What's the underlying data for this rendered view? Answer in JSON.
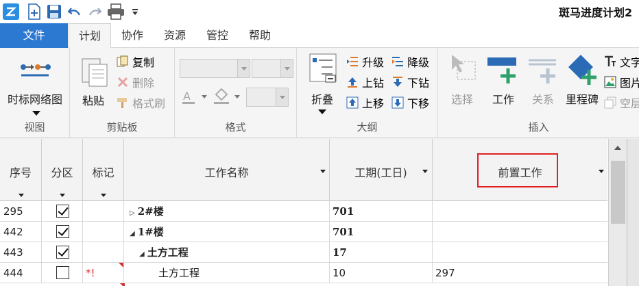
{
  "window": {
    "title": "斑马进度计划2"
  },
  "quick_access": {
    "icons": [
      "app-logo-icon",
      "new-file-icon",
      "save-icon",
      "undo-icon",
      "redo-icon",
      "print-icon",
      "customize-dropdown-icon"
    ]
  },
  "tabs": [
    {
      "label": "文件"
    },
    {
      "label": "计划"
    },
    {
      "label": "协作"
    },
    {
      "label": "资源"
    },
    {
      "label": "管控"
    },
    {
      "label": "帮助"
    }
  ],
  "ribbon": {
    "view": {
      "button": "时标网络图",
      "group": "视图"
    },
    "clipboard": {
      "paste": "粘贴",
      "copy": "复制",
      "delete": "删除",
      "format_painter": "格式刷",
      "group": "剪贴板"
    },
    "format": {
      "group": "格式"
    },
    "outline": {
      "fold": "折叠",
      "upgrade": "升级",
      "downgrade": "降级",
      "drill_up": "上钻",
      "drill_down": "下钻",
      "move_up": "上移",
      "move_down": "下移",
      "group": "大纲"
    },
    "insert": {
      "select": "选择",
      "task": "工作",
      "relation": "关系",
      "milestone": "里程碑",
      "text": "文字",
      "picture": "图片",
      "empty": "空层",
      "group": "插入"
    }
  },
  "grid": {
    "columns": [
      "序号",
      "分区",
      "标记",
      "工作名称",
      "工期(工日)",
      "前置工作"
    ],
    "rows": [
      {
        "seq": "295",
        "checked": true,
        "mark": "",
        "name": "2#楼",
        "duration": "701",
        "pred": "",
        "bold": true,
        "expander": "▷",
        "indent": 0
      },
      {
        "seq": "442",
        "checked": true,
        "mark": "",
        "name": "1#楼",
        "duration": "701",
        "pred": "",
        "bold": true,
        "expander": "◢",
        "indent": 0
      },
      {
        "seq": "443",
        "checked": true,
        "mark": "",
        "name": "土方工程",
        "duration": "17",
        "pred": "",
        "bold": true,
        "expander": "◢",
        "indent": 1
      },
      {
        "seq": "444",
        "checked": false,
        "mark": "*!",
        "name": "土方工程",
        "duration": "10",
        "pred": "297",
        "bold": false,
        "expander": "",
        "indent": 2
      }
    ]
  },
  "colors": {
    "accent": "#2b79d0",
    "highlight": "#e02020",
    "mark_red": "#d03030"
  }
}
